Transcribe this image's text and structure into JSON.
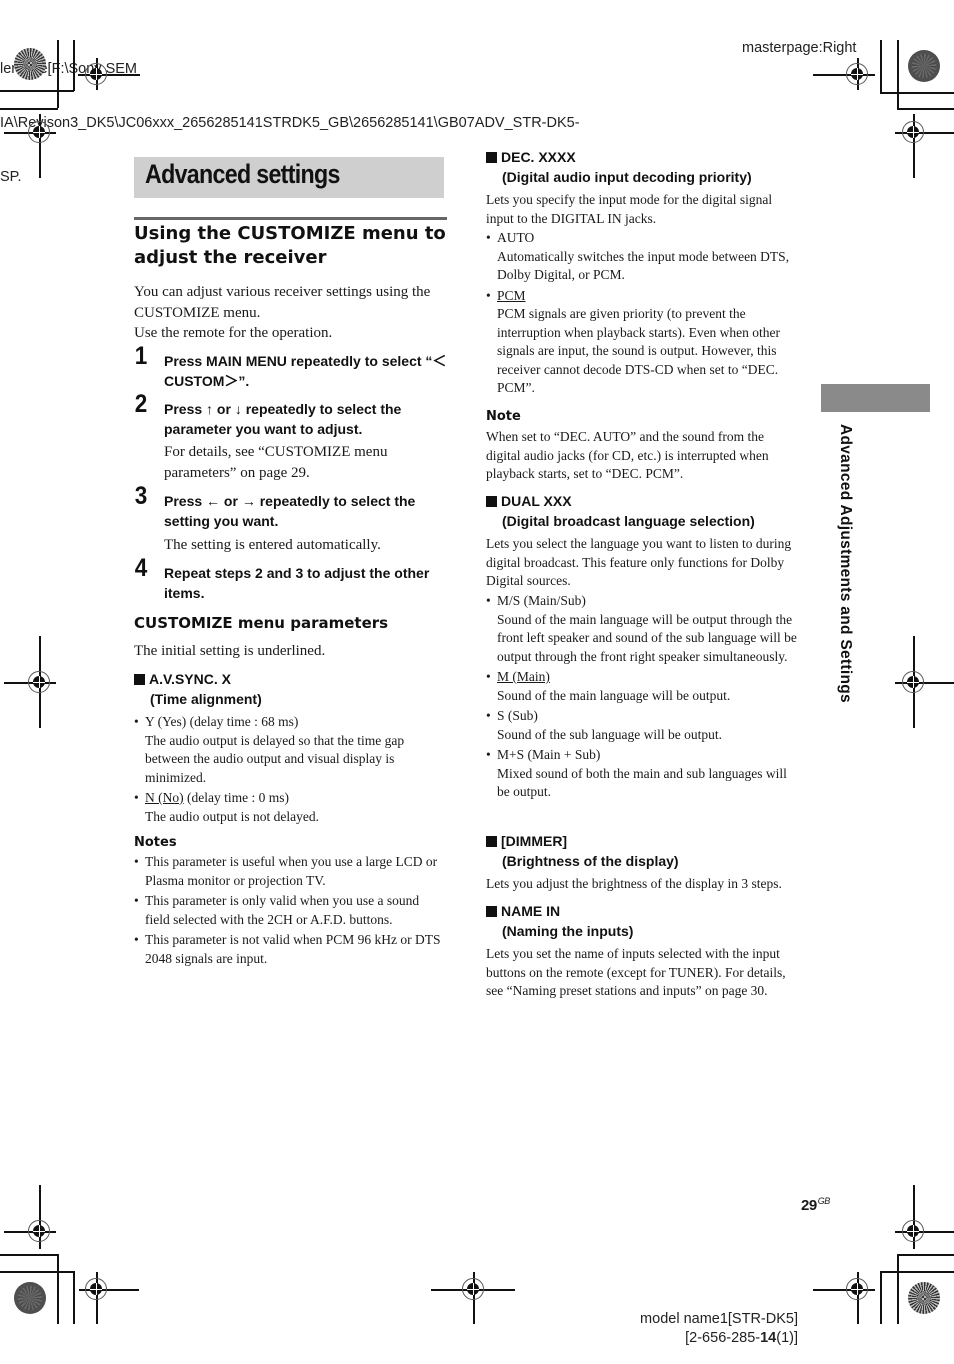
{
  "header": {
    "file_meta_lines": [
      "lename[F:\\Sony SEM",
      "IA\\Revison3_DK5\\JC06xxx_2656285141STRDK5_GB\\2656285141\\GB07ADV_STR-DK5-",
      "SP."
    ],
    "masterpage": "masterpage:Right"
  },
  "side_tab": {
    "label": "Advanced Adjustments and Settings"
  },
  "left": {
    "title": "Advanced settings",
    "section_heading": "Using the CUSTOMIZE menu to adjust the receiver",
    "intro": [
      "You can adjust various receiver settings using the CUSTOMIZE menu.",
      "Use the remote for the operation."
    ],
    "steps": [
      {
        "num": "1",
        "text": "Press MAIN MENU repeatedly to select “＜CUSTOM＞”.",
        "sub": ""
      },
      {
        "num": "2",
        "text": "Press ↑ or ↓ repeatedly to select the parameter you want to adjust.",
        "sub": "For details, see “CUSTOMIZE menu parameters” on page 29."
      },
      {
        "num": "3",
        "text": "Press ← or → repeatedly to select the setting you want.",
        "sub": "The setting is entered automatically."
      },
      {
        "num": "4",
        "text": "Repeat steps 2 and 3 to adjust the other items.",
        "sub": ""
      }
    ],
    "params_heading": "CUSTOMIZE menu parameters",
    "params_intro": "The initial setting is underlined.",
    "avsync": {
      "name": "A.V.SYNC. X",
      "desc": "(Time alignment)",
      "options": [
        {
          "label": "Y (Yes)",
          "extra": " (delay time : 68 ms)",
          "default": false,
          "text": "The audio output is delayed so that the time gap between the audio output and visual display is minimized."
        },
        {
          "label": "N (No)",
          "extra": " (delay time : 0 ms)",
          "default": true,
          "text": "The audio output is not delayed."
        }
      ],
      "notes_label": "Notes",
      "notes": [
        "This parameter is useful when you use a large LCD or Plasma monitor or projection TV.",
        "This parameter is only valid when you use a sound field selected with the 2CH or A.F.D. buttons.",
        "This parameter is not valid when PCM 96 kHz or DTS 2048 signals are input."
      ]
    }
  },
  "right": {
    "dec": {
      "name": "DEC. XXXX",
      "desc": "(Digital audio input decoding priority)",
      "intro": "Lets you specify the input mode for the digital signal input to the DIGITAL IN jacks.",
      "options": [
        {
          "label": "AUTO",
          "default": false,
          "text": "Automatically switches the input mode between DTS, Dolby Digital, or PCM."
        },
        {
          "label": "PCM",
          "default": true,
          "text": "PCM signals are given priority (to prevent the interruption when playback starts). Even when other signals are input, the sound is output. However, this receiver cannot decode DTS-CD when set to “DEC. PCM”."
        }
      ],
      "note_label": "Note",
      "note": "When set to “DEC. AUTO” and the sound from the digital audio jacks (for CD, etc.) is interrupted when playback starts, set to “DEC. PCM”."
    },
    "dual": {
      "name": "DUAL XXX",
      "desc": "(Digital broadcast language selection)",
      "intro": "Lets you select the language you want to listen to during digital broadcast. This feature only functions for Dolby Digital sources.",
      "options": [
        {
          "label": "M/S (Main/Sub)",
          "default": false,
          "text": "Sound of the main language will be output through the front left speaker and sound of the sub language will be output through the front right speaker simultaneously."
        },
        {
          "label": "M (Main)",
          "default": true,
          "text": "Sound of the main language will be output."
        },
        {
          "label": "S (Sub)",
          "default": false,
          "text": "Sound of the sub language will be output."
        },
        {
          "label": "M+S (Main + Sub)",
          "default": false,
          "text": "Mixed sound of both the main and sub languages will be output."
        }
      ]
    },
    "dimmer": {
      "name": "[DIMMER]",
      "desc": "(Brightness of the display)",
      "intro": "Lets you adjust the brightness of the display in 3 steps."
    },
    "name_in": {
      "name": "NAME IN",
      "desc": "(Naming the inputs)",
      "intro": "Lets you set the name of inputs selected with the input buttons on the remote (except for TUNER). For details, see “Naming preset stations and inputs” on page 30."
    }
  },
  "footer": {
    "page_number": "29",
    "page_suffix": "GB",
    "model_line1": "model name1[STR-DK5]",
    "model_line2_pre": "[2-656-285-",
    "model_line2_bold": "14",
    "model_line2_post": "(1)]"
  }
}
